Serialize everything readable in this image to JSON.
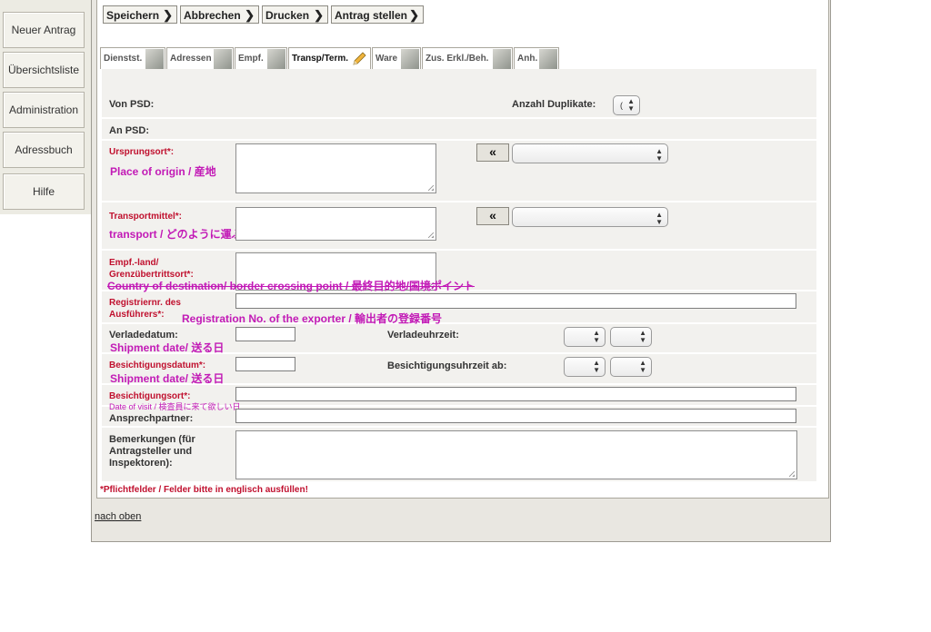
{
  "nav": {
    "items": [
      "Neuer Antrag",
      "Übersichtsliste",
      "Administration",
      "Adressbuch",
      "Hilfe"
    ]
  },
  "toolbar": {
    "save": "Speichern",
    "cancel": "Abbrechen",
    "print": "Drucken",
    "submit": "Antrag stellen"
  },
  "tabs": [
    "Dienstst.",
    "Adressen",
    "Empf.",
    "Transp/Term.",
    "Ware",
    "Zus. Erkl./Beh.",
    "Anh."
  ],
  "form": {
    "von_psd": "Von PSD:",
    "anzahl_duplikate": "Anzahl Duplikate:",
    "duplikate_value": "(",
    "an_psd": "An PSD:",
    "ursprungsort": "Ursprungsort*:",
    "ursprungsort_note": "Place of origin / 産地",
    "transportmittel": "Transportmittel*:",
    "transportmittel_note": "transport / どのように運ぶか",
    "empf_land": "Empf.-land/ Grenzübertrittsort*:",
    "empf_land_note": "Country of destination/ border crossing point / 最終目的地/国境ポイント",
    "registriernr": "Registriernr. des Ausführers*:",
    "registriernr_note": "Registration No. of the exporter / 輸出者の登録番号",
    "verladedatum": "Verladedatum:",
    "verladedatum_note": "Shipment date/ 送る日",
    "verladeuhrzeit": "Verladeuhrzeit:",
    "besichtigungsdatum": "Besichtigungsdatum*:",
    "besichtigungsdatum_note": "Shipment date/ 送る日",
    "besichtigungsuhrzeit": "Besichtigungsuhrzeit ab:",
    "besichtigungsort": "Besichtigungsort*:",
    "besichtigungsort_note": "Date of visit / 検査員に来て欲しい日",
    "ansprechpartner": "Ansprechpartner:",
    "bemerkungen": "Bemerkungen (für Antragsteller und Inspektoren):",
    "transfer_button": "«"
  },
  "footer": {
    "required_note": "*Pflichtfelder / Felder bitte in englisch ausfüllen!",
    "back_to_top": "nach oben"
  },
  "colors": {
    "required": "#c0102e",
    "annotation": "#c21ab6"
  }
}
